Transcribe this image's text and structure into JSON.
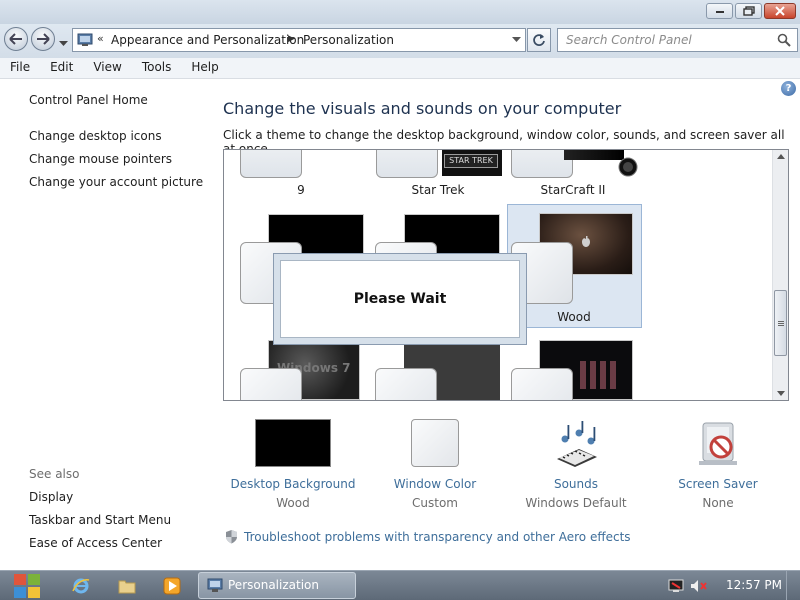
{
  "window": {
    "address": {
      "chevron": "«",
      "crumbs": [
        "Appearance and Personalization",
        "Personalization"
      ]
    },
    "search_placeholder": "Search Control Panel"
  },
  "menu": [
    "File",
    "Edit",
    "View",
    "Tools",
    "Help"
  ],
  "left_panel": {
    "home": "Control Panel Home",
    "links": [
      "Change desktop icons",
      "Change mouse pointers",
      "Change your account picture"
    ],
    "see_also_title": "See also",
    "see_also": [
      "Display",
      "Taskbar and Start Menu",
      "Ease of Access Center"
    ]
  },
  "main": {
    "heading": "Change the visuals and sounds on your computer",
    "subheading": "Click a theme to change the desktop background, window color, sounds, and screen saver all at once.",
    "themes_row1": [
      "9",
      "Star Trek",
      "StarCraft II"
    ],
    "selected_theme": "Wood",
    "star_trek_logo": "STAR TREK",
    "windows7_caption": "Windows 7",
    "dialog_text": "Please Wait"
  },
  "bottom": [
    {
      "caption": "Desktop Background",
      "value": "Wood",
      "icon": "desktop-background-icon"
    },
    {
      "caption": "Window Color",
      "value": "Custom",
      "icon": "window-color-icon"
    },
    {
      "caption": "Sounds",
      "value": "Windows Default",
      "icon": "sounds-icon"
    },
    {
      "caption": "Screen Saver",
      "value": "None",
      "icon": "screen-saver-icon"
    }
  ],
  "troubleshoot": "Troubleshoot problems with transparency and other Aero effects",
  "taskbar": {
    "window_label": "Personalization",
    "clock": "12:57 PM"
  },
  "colors": {
    "link": "#3e6e9a",
    "heading": "#1e3250",
    "selection": "#dce6f2"
  }
}
